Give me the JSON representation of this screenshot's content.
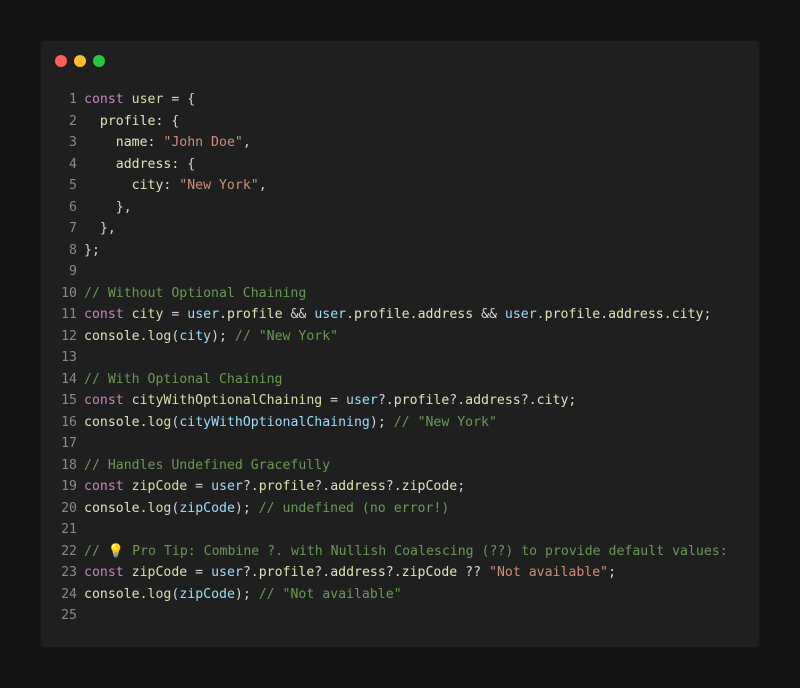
{
  "window": {
    "buttons": [
      {
        "name": "close",
        "color": "#ff5f57"
      },
      {
        "name": "minimize",
        "color": "#febc2e"
      },
      {
        "name": "maximize",
        "color": "#28c840"
      }
    ]
  },
  "colors": {
    "keyword": "#c586c0",
    "variable": "#9cdcfe",
    "function": "#dcdcaa",
    "string": "#ce9178",
    "comment": "#6a9955",
    "punctuation": "#d4d4d4",
    "line_number": "#8a8a8a",
    "editor_bg": "#1f1f1f",
    "page_bg": "#151515"
  },
  "code_lines": [
    {
      "num": "1",
      "tokens": [
        [
          "kw",
          "const"
        ],
        [
          "pun",
          " "
        ],
        [
          "fn",
          "user"
        ],
        [
          "pun",
          " = {"
        ]
      ]
    },
    {
      "num": "2",
      "tokens": [
        [
          "pun",
          "  "
        ],
        [
          "prop",
          "profile"
        ],
        [
          "pun",
          ": {"
        ]
      ]
    },
    {
      "num": "3",
      "tokens": [
        [
          "pun",
          "    "
        ],
        [
          "prop",
          "name"
        ],
        [
          "pun",
          ": "
        ],
        [
          "str",
          "\"John Doe\""
        ],
        [
          "pun",
          ","
        ]
      ]
    },
    {
      "num": "4",
      "tokens": [
        [
          "pun",
          "    "
        ],
        [
          "prop",
          "address"
        ],
        [
          "pun",
          ": {"
        ]
      ]
    },
    {
      "num": "5",
      "tokens": [
        [
          "pun",
          "      "
        ],
        [
          "prop",
          "city"
        ],
        [
          "pun",
          ": "
        ],
        [
          "str",
          "\"New York\""
        ],
        [
          "pun",
          ","
        ]
      ]
    },
    {
      "num": "6",
      "tokens": [
        [
          "pun",
          "    },"
        ]
      ]
    },
    {
      "num": "7",
      "tokens": [
        [
          "pun",
          "  },"
        ]
      ]
    },
    {
      "num": "8",
      "tokens": [
        [
          "pun",
          "};"
        ]
      ]
    },
    {
      "num": "9",
      "tokens": []
    },
    {
      "num": "10",
      "tokens": [
        [
          "cmt",
          "// Without Optional Chaining"
        ]
      ]
    },
    {
      "num": "11",
      "tokens": [
        [
          "kw",
          "const"
        ],
        [
          "pun",
          " "
        ],
        [
          "fn",
          "city"
        ],
        [
          "pun",
          " = "
        ],
        [
          "var",
          "user"
        ],
        [
          "pun",
          "."
        ],
        [
          "prop",
          "profile"
        ],
        [
          "pun",
          " && "
        ],
        [
          "var",
          "user"
        ],
        [
          "pun",
          "."
        ],
        [
          "prop",
          "profile"
        ],
        [
          "pun",
          "."
        ],
        [
          "prop",
          "address"
        ],
        [
          "pun",
          " && "
        ],
        [
          "var",
          "user"
        ],
        [
          "pun",
          "."
        ],
        [
          "prop",
          "profile"
        ],
        [
          "pun",
          "."
        ],
        [
          "prop",
          "address"
        ],
        [
          "pun",
          "."
        ],
        [
          "prop",
          "city"
        ],
        [
          "pun",
          ";"
        ]
      ]
    },
    {
      "num": "12",
      "tokens": [
        [
          "prop",
          "console"
        ],
        [
          "pun",
          "."
        ],
        [
          "fn",
          "log"
        ],
        [
          "pun",
          "("
        ],
        [
          "var",
          "city"
        ],
        [
          "pun",
          "); "
        ],
        [
          "cmt",
          "// \"New York\""
        ]
      ]
    },
    {
      "num": "13",
      "tokens": []
    },
    {
      "num": "14",
      "tokens": [
        [
          "cmt",
          "// With Optional Chaining"
        ]
      ]
    },
    {
      "num": "15",
      "tokens": [
        [
          "kw",
          "const"
        ],
        [
          "pun",
          " "
        ],
        [
          "fn",
          "cityWithOptionalChaining"
        ],
        [
          "pun",
          " = "
        ],
        [
          "var",
          "user"
        ],
        [
          "pun",
          "?."
        ],
        [
          "prop",
          "profile"
        ],
        [
          "pun",
          "?."
        ],
        [
          "prop",
          "address"
        ],
        [
          "pun",
          "?."
        ],
        [
          "prop",
          "city"
        ],
        [
          "pun",
          ";"
        ]
      ]
    },
    {
      "num": "16",
      "tokens": [
        [
          "prop",
          "console"
        ],
        [
          "pun",
          "."
        ],
        [
          "fn",
          "log"
        ],
        [
          "pun",
          "("
        ],
        [
          "var",
          "cityWithOptionalChaining"
        ],
        [
          "pun",
          "); "
        ],
        [
          "cmt",
          "// \"New York\""
        ]
      ]
    },
    {
      "num": "17",
      "tokens": []
    },
    {
      "num": "18",
      "tokens": [
        [
          "cmt",
          "// Handles Undefined Gracefully"
        ]
      ]
    },
    {
      "num": "19",
      "tokens": [
        [
          "kw",
          "const"
        ],
        [
          "pun",
          " "
        ],
        [
          "fn",
          "zipCode"
        ],
        [
          "pun",
          " = "
        ],
        [
          "var",
          "user"
        ],
        [
          "pun",
          "?."
        ],
        [
          "prop",
          "profile"
        ],
        [
          "pun",
          "?."
        ],
        [
          "prop",
          "address"
        ],
        [
          "pun",
          "?."
        ],
        [
          "prop",
          "zipCode"
        ],
        [
          "pun",
          ";"
        ]
      ]
    },
    {
      "num": "20",
      "tokens": [
        [
          "prop",
          "console"
        ],
        [
          "pun",
          "."
        ],
        [
          "fn",
          "log"
        ],
        [
          "pun",
          "("
        ],
        [
          "var",
          "zipCode"
        ],
        [
          "pun",
          "); "
        ],
        [
          "cmt",
          "// undefined (no error!)"
        ]
      ]
    },
    {
      "num": "21",
      "tokens": []
    },
    {
      "num": "22",
      "tokens": [
        [
          "cmt",
          "// 💡 Pro Tip: Combine ?. with Nullish Coalescing (??) to provide default values:"
        ]
      ]
    },
    {
      "num": "23",
      "tokens": [
        [
          "kw",
          "const"
        ],
        [
          "pun",
          " "
        ],
        [
          "fn",
          "zipCode"
        ],
        [
          "pun",
          " = "
        ],
        [
          "var",
          "user"
        ],
        [
          "pun",
          "?."
        ],
        [
          "prop",
          "profile"
        ],
        [
          "pun",
          "?."
        ],
        [
          "prop",
          "address"
        ],
        [
          "pun",
          "?."
        ],
        [
          "prop",
          "zipCode"
        ],
        [
          "pun",
          " ?? "
        ],
        [
          "str",
          "\"Not available\""
        ],
        [
          "pun",
          ";"
        ]
      ]
    },
    {
      "num": "24",
      "tokens": [
        [
          "prop",
          "console"
        ],
        [
          "pun",
          "."
        ],
        [
          "fn",
          "log"
        ],
        [
          "pun",
          "("
        ],
        [
          "var",
          "zipCode"
        ],
        [
          "pun",
          "); "
        ],
        [
          "cmt",
          "// \"Not available\""
        ]
      ]
    },
    {
      "num": "25",
      "tokens": []
    }
  ]
}
